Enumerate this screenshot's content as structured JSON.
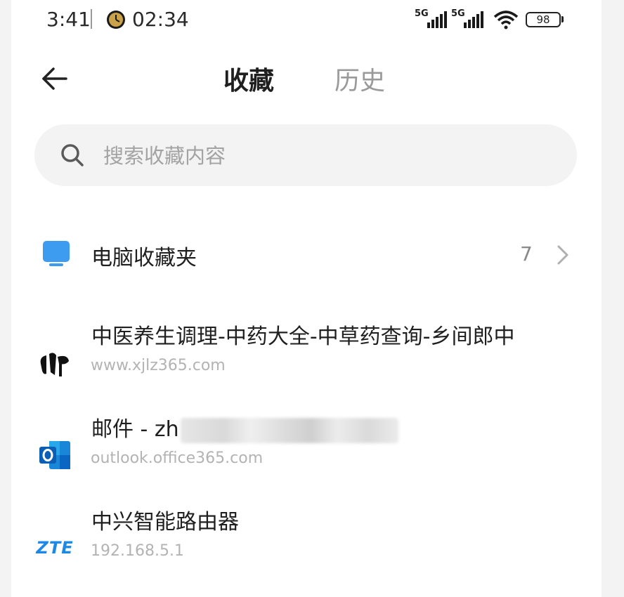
{
  "status_bar": {
    "time": "3:41",
    "clock_time": "02:34",
    "network1": "5G",
    "network2": "5G",
    "battery": "98",
    "icons": [
      "clock-icon",
      "signal-icon",
      "wifi-icon",
      "battery-icon"
    ]
  },
  "header": {
    "tabs": [
      {
        "label": "收藏",
        "active": true
      },
      {
        "label": "历史",
        "active": false
      }
    ]
  },
  "search": {
    "placeholder": "搜索收藏内容",
    "value": ""
  },
  "folder": {
    "label": "电脑收藏夹",
    "count": "7",
    "icon": "monitor-icon"
  },
  "bookmarks": [
    {
      "title": "中医养生调理-中药大全-中草药查询-乡间郎中",
      "url": "www.xjlz365.com",
      "icon": "xjlz-logo-icon"
    },
    {
      "title": "邮件 - zh",
      "url": "outlook.office365.com",
      "icon": "outlook-icon"
    },
    {
      "title": "中兴智能路由器",
      "url": "192.168.5.1",
      "icon": "zte-logo-icon",
      "logo_text": "ZTE"
    }
  ],
  "colors": {
    "accent_blue": "#3d9cf0",
    "text_primary": "#1f1f1f",
    "text_secondary": "#b3b3b3",
    "search_bg": "#f3f3f3",
    "outlook_blue": "#0a66c2",
    "zte_blue": "#1e88e5"
  }
}
